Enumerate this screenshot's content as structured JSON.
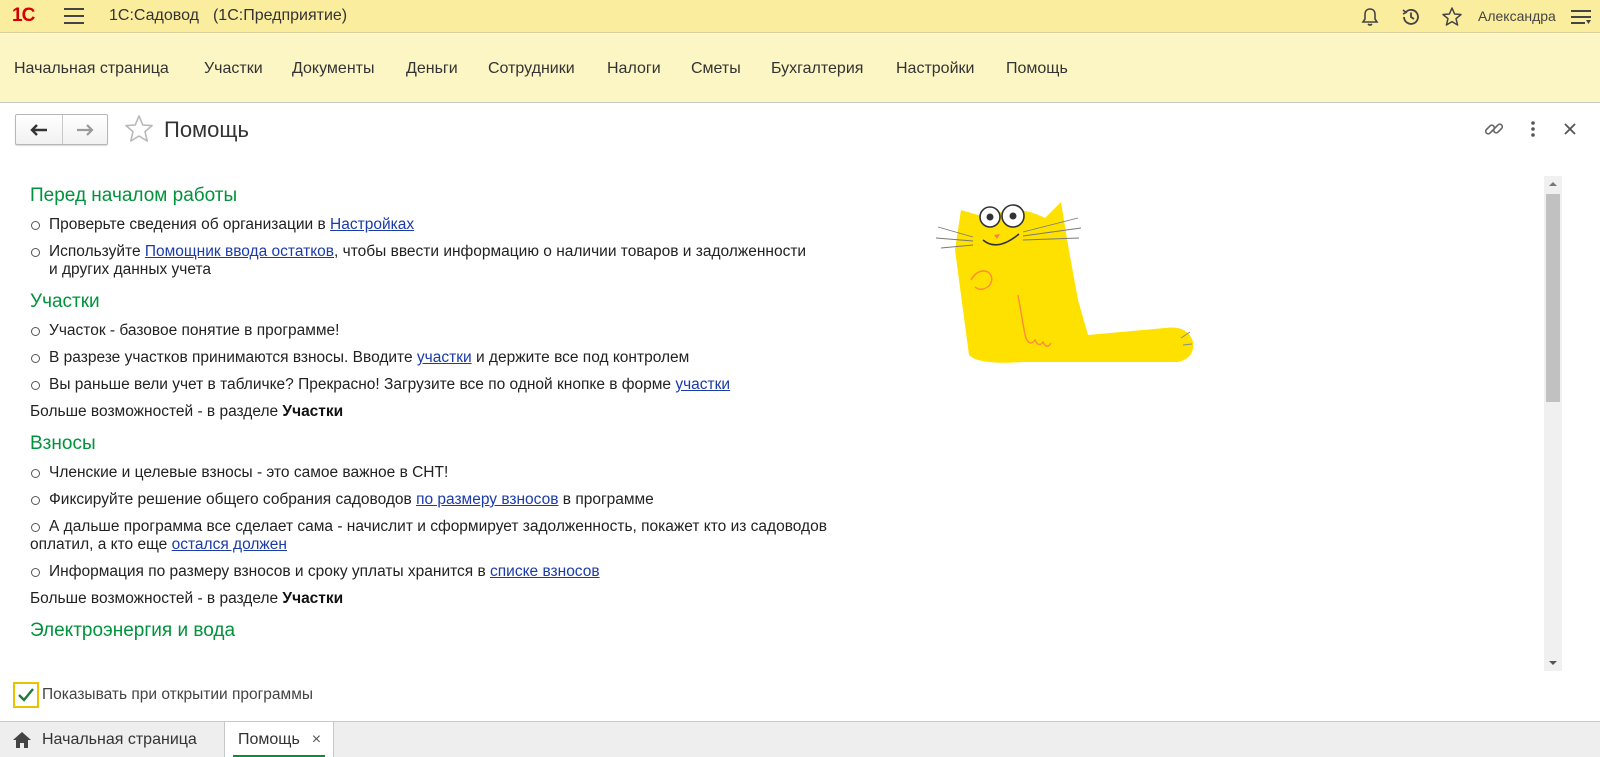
{
  "titlebar": {
    "logo": "1C",
    "app_name": "1С:Садовод",
    "platform": "(1С:Предприятие)",
    "user": "Александра"
  },
  "sections": [
    "Начальная страница",
    "Участки",
    "Документы",
    "Деньги",
    "Сотрудники",
    "Налоги",
    "Сметы",
    "Бухгалтерия",
    "Настройки",
    "Помощь"
  ],
  "form": {
    "title": "Помощь"
  },
  "content": {
    "s1": {
      "title": "Перед началом работы",
      "i1_pre": "Проверьте сведения об организации в ",
      "i1_link": "Настройках",
      "i2_pre": "Используйте ",
      "i2_link": "Помощник ввода остатков",
      "i2_post": ", чтобы ввести информацию о наличии товаров и задолженности",
      "i2_post2": "и других данных учета"
    },
    "s2": {
      "title": "Участки",
      "i1": "Участок - базовое понятие в программе!",
      "i2_pre": "В разрезе участков принимаются взносы. Вводите ",
      "i2_link": "участки",
      "i2_post": " и держите все под контролем",
      "i3_pre": "Вы раньше вели учет в табличке? Прекрасно! Загрузите все по одной кнопке в форме ",
      "i3_link": "участки",
      "more_pre": "Больше возможностей - в разделе ",
      "more_bold": "Участки"
    },
    "s3": {
      "title": "Взносы",
      "i1": "Членские и целевые взносы - это самое важное в СНТ!",
      "i2_pre": "Фиксируйте решение общего собрания садоводов ",
      "i2_link": "по размеру взносов",
      "i2_post": " в программе",
      "i3_pre": "А дальше программа все сделает сама - начислит и сформирует задолженность, покажет кто из садоводов",
      "i3_pre2": "оплатил, а кто еще ",
      "i3_link": "остался должен",
      "i4_pre": "Информация по размеру взносов и сроку уплаты хранится в ",
      "i4_link": "списке взносов",
      "more_pre": "Больше возможностей - в разделе ",
      "more_bold": "Участки"
    },
    "s4": {
      "title": "Электроэнергия и вода"
    }
  },
  "checkbox": {
    "label": "Показывать при открытии программы",
    "checked": true
  },
  "tabs": [
    {
      "label": "Начальная страница",
      "icon": "home-icon"
    },
    {
      "label": "Помощь",
      "close": "×"
    }
  ],
  "colors": {
    "titlebar": "#fbed9e",
    "sections": "#fcf6c4",
    "heading": "#00933b",
    "link": "#1a3ba8",
    "cat": "#ffe100"
  }
}
